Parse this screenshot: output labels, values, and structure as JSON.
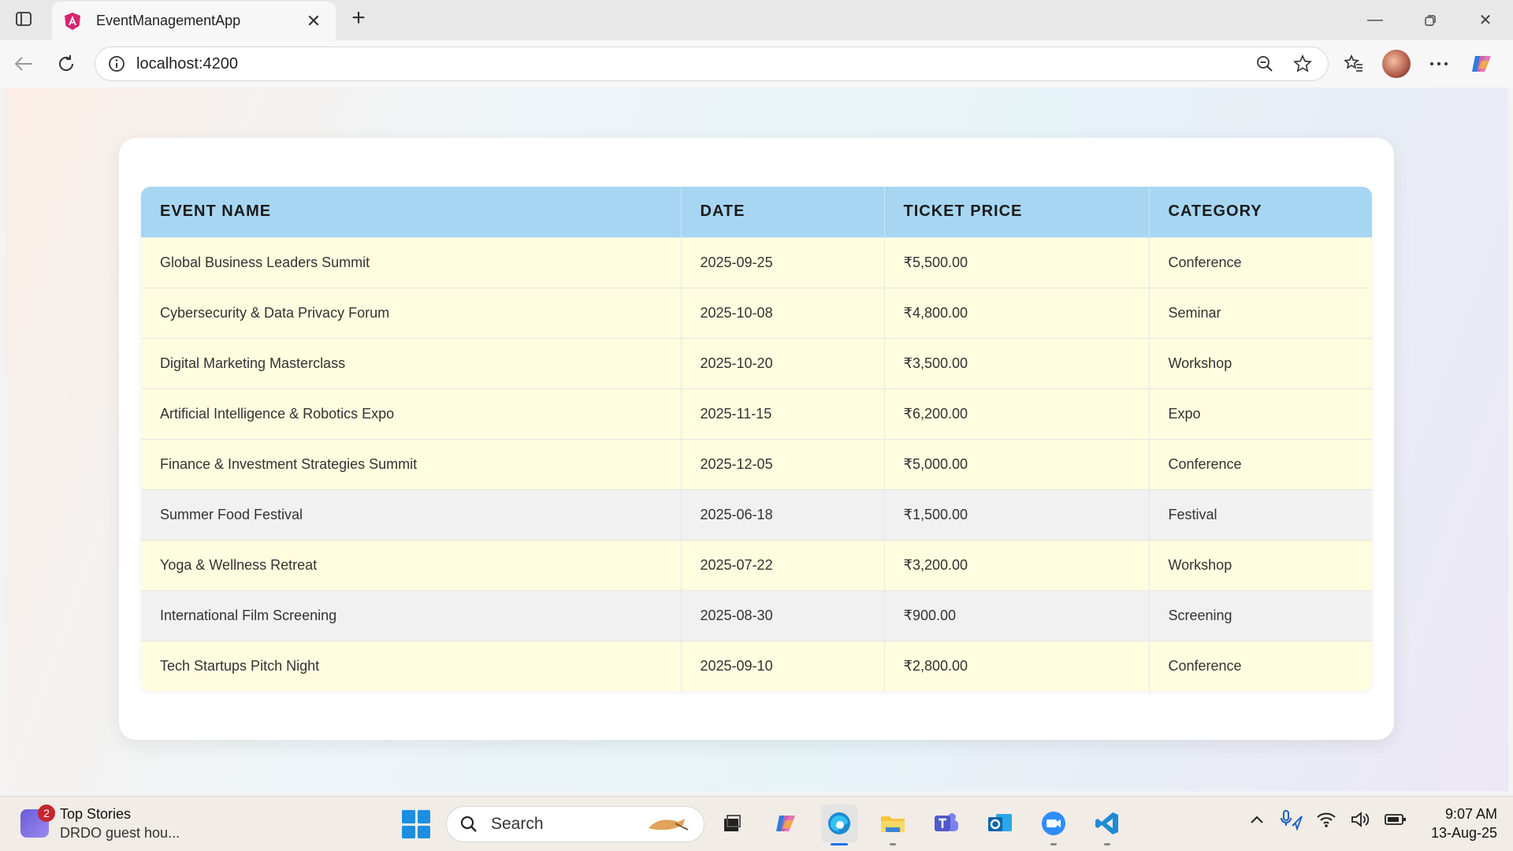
{
  "browser": {
    "tab_title": "EventManagementApp",
    "address": "localhost:4200"
  },
  "table": {
    "headers": [
      "EVENT NAME",
      "DATE",
      "TICKET PRICE",
      "CATEGORY"
    ],
    "rows": [
      {
        "name": "Global Business Leaders Summit",
        "date": "2025-09-25",
        "price": "₹5,500.00",
        "category": "Conference",
        "style": "yellow"
      },
      {
        "name": "Cybersecurity & Data Privacy Forum",
        "date": "2025-10-08",
        "price": "₹4,800.00",
        "category": "Seminar",
        "style": "yellow"
      },
      {
        "name": "Digital Marketing Masterclass",
        "date": "2025-10-20",
        "price": "₹3,500.00",
        "category": "Workshop",
        "style": "yellow"
      },
      {
        "name": "Artificial Intelligence & Robotics Expo",
        "date": "2025-11-15",
        "price": "₹6,200.00",
        "category": "Expo",
        "style": "yellow"
      },
      {
        "name": "Finance & Investment Strategies Summit",
        "date": "2025-12-05",
        "price": "₹5,000.00",
        "category": "Conference",
        "style": "yellow"
      },
      {
        "name": "Summer Food Festival",
        "date": "2025-06-18",
        "price": "₹1,500.00",
        "category": "Festival",
        "style": "grey"
      },
      {
        "name": "Yoga & Wellness Retreat",
        "date": "2025-07-22",
        "price": "₹3,200.00",
        "category": "Workshop",
        "style": "yellow"
      },
      {
        "name": "International Film Screening",
        "date": "2025-08-30",
        "price": "₹900.00",
        "category": "Screening",
        "style": "grey"
      },
      {
        "name": "Tech Startups Pitch Night",
        "date": "2025-09-10",
        "price": "₹2,800.00",
        "category": "Conference",
        "style": "yellow"
      }
    ]
  },
  "taskbar": {
    "news_badge": "2",
    "news_title": "Top Stories",
    "news_sub": "DRDO guest hou...",
    "search_label": "Search",
    "time": "9:07 AM",
    "date": "13-Aug-25"
  },
  "colors": {
    "header_bg": "#a6d6f2",
    "row_yellow": "#fffde0",
    "row_grey": "#f1f1f1",
    "edge_accent": "#1a73e8"
  }
}
